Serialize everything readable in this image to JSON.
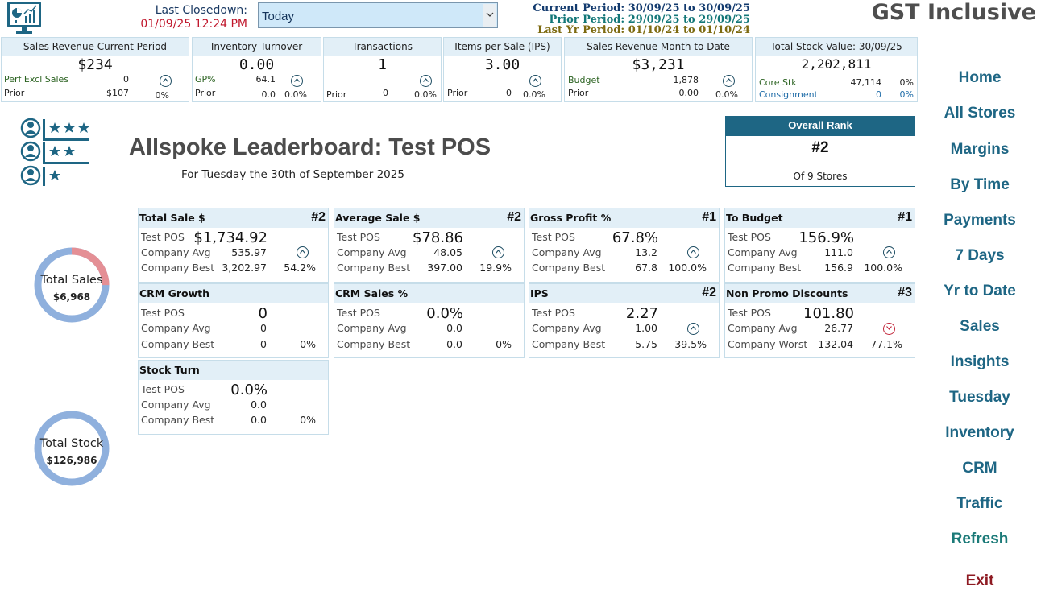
{
  "header": {
    "closedown_label": "Last Closedown:",
    "closedown_value": "01/09/25 12:24 PM",
    "period_selected": "Today",
    "current_period": "Current Period: 30/09/25 to 30/09/25",
    "prior_period": "Prior Period: 29/09/25 to 29/09/25",
    "last_yr_period": "Last Yr Period: 01/10/24 to 01/10/24",
    "gst_label": "GST Inclusive"
  },
  "kpis": {
    "sales_revenue": {
      "title": "Sales Revenue Current Period",
      "value": "$234",
      "perf_label": "Perf Excl Sales",
      "perf_value": "0",
      "prior_label": "Prior",
      "prior_value": "$107",
      "prior_pct": "0%"
    },
    "inventory_turnover": {
      "title": "Inventory Turnover",
      "value": "0.00",
      "gp_label": "GP%",
      "gp_value": "64.1",
      "prior_label": "Prior",
      "prior_value": "0.0",
      "prior_pct": "0.0%"
    },
    "transactions": {
      "title": "Transactions",
      "value": "1",
      "prior_label": "Prior",
      "prior_value": "0",
      "prior_pct": "0.0%"
    },
    "ips": {
      "title": "Items per Sale (IPS)",
      "value": "3.00",
      "prior_label": "Prior",
      "prior_value": "0",
      "prior_pct": "0.0%"
    },
    "month_to_date": {
      "title": "Sales Revenue Month to Date",
      "value": "$3,231",
      "budget_label": "Budget",
      "budget_value": "1,878",
      "prior_label": "Prior",
      "prior_value": "0.00",
      "prior_pct": "0.0%"
    },
    "stock_value": {
      "title": "Total Stock Value: 30/09/25",
      "value": "2,202,811",
      "core_label": "Core Stk",
      "core_value": "47,114",
      "core_pct": "0%",
      "consign_label": "Consignment",
      "consign_value": "0",
      "consign_pct": "0%"
    }
  },
  "leaderboard": {
    "title": "Allspoke Leaderboard: Test POS",
    "subtitle": "For Tuesday the 30th of September 2025",
    "overall_rank_label": "Overall Rank",
    "overall_rank_value": "#2",
    "overall_rank_of": "Of 9 Stores"
  },
  "donuts": {
    "sales": {
      "label": "Total Sales",
      "value": "$6,968",
      "store_share": 0.25,
      "store_color": "#e48f95",
      "base_color": "#8fb0dd"
    },
    "stock": {
      "label": "Total Stock",
      "value": "$126,986",
      "store_share": 0.0,
      "store_color": "#e48f95",
      "base_color": "#8fb0dd"
    }
  },
  "cards": {
    "total_sale": {
      "title": "Total Sale $",
      "rank": "#2",
      "store_label": "Test POS",
      "store_value": "$1,734.92",
      "avg_label": "Company Avg",
      "avg_value": "535.97",
      "best_label": "Company Best",
      "best_value": "3,202.97",
      "pct": "54.2%"
    },
    "average_sale": {
      "title": "Average Sale $",
      "rank": "#2",
      "store_label": "Test POS",
      "store_value": "$78.86",
      "avg_label": "Company Avg",
      "avg_value": "48.05",
      "best_label": "Company Best",
      "best_value": "397.00",
      "pct": "19.9%"
    },
    "gross_profit": {
      "title": "Gross Profit %",
      "rank": "#1",
      "store_label": "Test POS",
      "store_value": "67.8%",
      "avg_label": "Company Avg",
      "avg_value": "13.2",
      "best_label": "Company Best",
      "best_value": "67.8",
      "pct": "100.0%"
    },
    "to_budget": {
      "title": "To Budget",
      "rank": "#1",
      "store_label": "Test POS",
      "store_value": "156.9%",
      "avg_label": "Company Avg",
      "avg_value": "111.0",
      "best_label": "Company Best",
      "best_value": "156.9",
      "pct": "100.0%"
    },
    "crm_growth": {
      "title": "CRM Growth",
      "rank": "",
      "store_label": "Test POS",
      "store_value": "0",
      "avg_label": "Company Avg",
      "avg_value": "0",
      "best_label": "Company Best",
      "best_value": "0",
      "pct": "0%"
    },
    "crm_sales": {
      "title": "CRM Sales %",
      "rank": "",
      "store_label": "Test POS",
      "store_value": "0.0%",
      "avg_label": "Company Avg",
      "avg_value": "0.0",
      "best_label": "Company Best",
      "best_value": "0.0",
      "pct": "0%"
    },
    "ips": {
      "title": "IPS",
      "rank": "#2",
      "store_label": "Test POS",
      "store_value": "2.27",
      "avg_label": "Company Avg",
      "avg_value": "1.00",
      "best_label": "Company Best",
      "best_value": "5.75",
      "pct": "39.5%"
    },
    "non_promo": {
      "title": "Non Promo Discounts",
      "rank": "#3",
      "store_label": "Test POS",
      "store_value": "101.80",
      "avg_label": "Company Avg",
      "avg_value": "26.77",
      "best_label": "Company Worst",
      "best_value": "132.04",
      "pct": "77.1%"
    },
    "stock_turn": {
      "title": "Stock Turn",
      "rank": "",
      "store_label": "Test POS",
      "store_value": "0.0%",
      "avg_label": "Company Avg",
      "avg_value": "0.0",
      "best_label": "Company Best",
      "best_value": "0.0",
      "pct": "0%"
    }
  },
  "nav": {
    "home": "Home",
    "all_stores": "All Stores",
    "margins": "Margins",
    "by_time": "By Time",
    "payments": "Payments",
    "seven_days": "7 Days",
    "yr_to_date": "Yr to Date",
    "sales": "Sales",
    "insights": "Insights",
    "tuesday": "Tuesday",
    "inventory": "Inventory",
    "crm": "CRM",
    "traffic": "Traffic",
    "refresh": "Refresh",
    "exit": "Exit"
  },
  "colors": {
    "accent": "#1e6684",
    "header_bg": "#e2eff7",
    "alert_red": "#c0162b",
    "nav_exit": "#8e1a22"
  },
  "icons": {
    "logo": "dashboard-monitor-icon",
    "leaderboard": "ranked-people-icon",
    "up": "chevron-up-circle-icon",
    "down": "chevron-down-circle-icon"
  }
}
